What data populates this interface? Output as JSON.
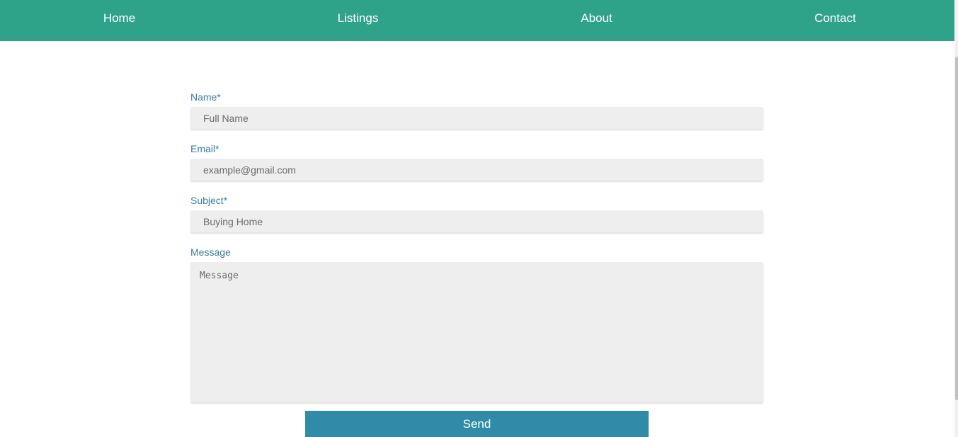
{
  "nav": {
    "items": [
      {
        "label": "Home"
      },
      {
        "label": "Listings"
      },
      {
        "label": "About"
      },
      {
        "label": "Contact"
      }
    ]
  },
  "form": {
    "name": {
      "label": "Name*",
      "placeholder": "Full Name"
    },
    "email": {
      "label": "Email*",
      "placeholder": "example@gmail.com"
    },
    "subject": {
      "label": "Subject*",
      "placeholder": "Buying Home"
    },
    "message": {
      "label": "Message",
      "placeholder": "Message"
    },
    "submit_label": "Send"
  },
  "colors": {
    "nav_background": "#2fa38a",
    "label_text": "#3a7f9c",
    "input_background": "#eeeeee",
    "button_background": "#308ba8"
  }
}
